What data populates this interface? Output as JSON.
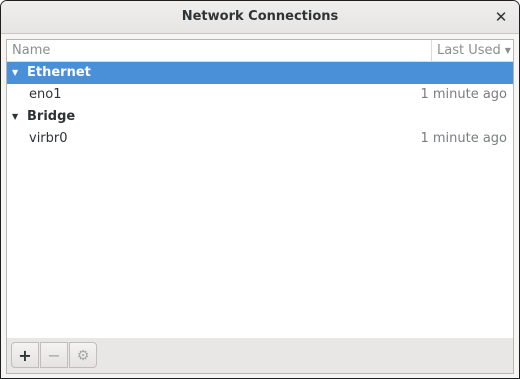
{
  "window": {
    "title": "Network Connections",
    "close_glyph": "✕"
  },
  "columns": {
    "name": "Name",
    "last_used": "Last Used",
    "sort_glyph": "▼"
  },
  "groups": [
    {
      "label": "Ethernet",
      "expanded_glyph": "▼",
      "selected": true,
      "connections": [
        {
          "name": "eno1",
          "last_used": "1 minute ago"
        }
      ]
    },
    {
      "label": "Bridge",
      "expanded_glyph": "▼",
      "selected": false,
      "connections": [
        {
          "name": "virbr0",
          "last_used": "1 minute ago"
        }
      ]
    }
  ],
  "toolbar": {
    "add_glyph": "+",
    "remove_glyph": "−",
    "settings_glyph": "⚙",
    "add_icon": "plus-icon",
    "remove_icon": "minus-icon",
    "settings_icon": "gear-icon"
  },
  "colors": {
    "selection": "#4a90d9",
    "selection_text": "#ffffff"
  }
}
